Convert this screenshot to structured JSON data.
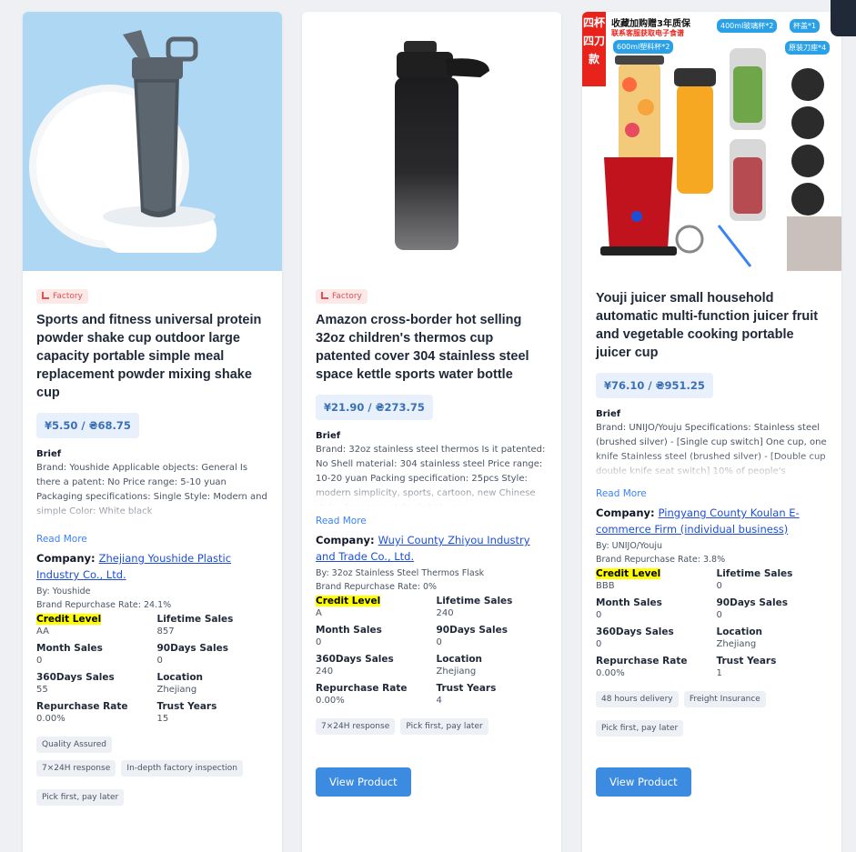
{
  "products": [
    {
      "badge": "Factory",
      "title": "Sports and fitness universal protein powder shake cup outdoor large capacity portable simple meal replacement powder mixing shake cup",
      "price": "¥5.50 / ₴68.75",
      "brief_label": "Brief",
      "brief": "Brand: Youshide Applicable objects: General Is there a patent: No Price range: 5-10 yuan Packaging specifications: Single Style: Modern and simple Color: White black",
      "read_more": "Read More",
      "company_label": "Company:",
      "company_name": "Zhejiang Youshide Plastic Industry Co., Ltd.",
      "by": "By: Youshide",
      "brand_repurchase": "Brand Repurchase Rate: 24.1%",
      "stats": [
        {
          "label": "Credit Level",
          "value": "AA"
        },
        {
          "label": "Lifetime Sales",
          "value": "857"
        },
        {
          "label": "Month Sales",
          "value": "0"
        },
        {
          "label": "90Days Sales",
          "value": "0"
        },
        {
          "label": "360Days Sales",
          "value": "55"
        },
        {
          "label": "Location",
          "value": "Zhejiang"
        },
        {
          "label": "Repurchase Rate",
          "value": "0.00%"
        },
        {
          "label": "Trust Years",
          "value": "15"
        }
      ],
      "tags": [
        "Quality Assured",
        "7×24H response",
        "In-depth factory inspection"
      ],
      "tags_b": [
        "Pick first, pay later"
      ],
      "button": "View Product"
    },
    {
      "badge": "Factory",
      "title": "Amazon cross-border hot selling 32oz children's thermos cup patented cover 304 stainless steel space kettle sports water bottle",
      "price": "¥21.90 / ₴273.75",
      "brief_label": "Brief",
      "brief": "Brand: 32oz stainless steel thermos Is it patented: No Shell material: 304 stainless steel Price range: 10-20 yuan Packing specification: 25pcs Style: modern simplicity, sports, cartoon, new Chinese style, American style, light luxury",
      "read_more": "Read More",
      "company_label": "Company:",
      "company_name": "Wuyi County Zhiyou Industry and Trade Co., Ltd.",
      "by": "By: 32oz Stainless Steel Thermos Flask",
      "brand_repurchase": "Brand Repurchase Rate: 0%",
      "stats": [
        {
          "label": "Credit Level",
          "value": "A"
        },
        {
          "label": "Lifetime Sales",
          "value": "240"
        },
        {
          "label": "Month Sales",
          "value": "0"
        },
        {
          "label": "90Days Sales",
          "value": "0"
        },
        {
          "label": "360Days Sales",
          "value": "240"
        },
        {
          "label": "Location",
          "value": "Zhejiang"
        },
        {
          "label": "Repurchase Rate",
          "value": "0.00%"
        },
        {
          "label": "Trust Years",
          "value": "4"
        }
      ],
      "tags": [
        "7×24H response",
        "Pick first, pay later"
      ],
      "tags_b": [],
      "button": "View Product"
    },
    {
      "badge": "",
      "title": "Youji juicer small household automatic multi-function juicer fruit and vegetable cooking portable juicer cup",
      "price": "¥76.10 / ₴951.25",
      "brief_label": "Brief",
      "brief": "Brand: UNIJO/Youju Specifications: Stainless steel (brushed silver) - [Single cup switch] One cup, one knife Stainless steel (brushed silver) - [Double cup double knife seat switch] 10% of people's",
      "read_more": "Read More",
      "company_label": "Company:",
      "company_name": "Pingyang County Koulan E-commerce Firm (individual business)",
      "by": "By: UNIJO/Youju",
      "brand_repurchase": "Brand Repurchase Rate: 3.8%",
      "stats": [
        {
          "label": "Credit Level",
          "value": "BBB"
        },
        {
          "label": "Lifetime Sales",
          "value": "0"
        },
        {
          "label": "Month Sales",
          "value": "0"
        },
        {
          "label": "90Days Sales",
          "value": "0"
        },
        {
          "label": "360Days Sales",
          "value": "0"
        },
        {
          "label": "Location",
          "value": "Zhejiang"
        },
        {
          "label": "Repurchase Rate",
          "value": "0.00%"
        },
        {
          "label": "Trust Years",
          "value": "1"
        }
      ],
      "tags": [
        "48 hours delivery",
        "Freight Insurance"
      ],
      "tags_b": [
        "Pick first, pay later"
      ],
      "button": "View Product",
      "image_text": {
        "red_banner": "四杯四刀款",
        "top_line_1": "收藏加购赠3年质保",
        "top_line_2": "联系客服获取电子食谱",
        "label_600": "600ml塑料杯*2",
        "label_400": "400ml玻璃杯*2",
        "label_lid": "杯盖*1",
        "label_blade": "原装刀座*4",
        "brand_on_base": "UNIJO"
      }
    }
  ]
}
